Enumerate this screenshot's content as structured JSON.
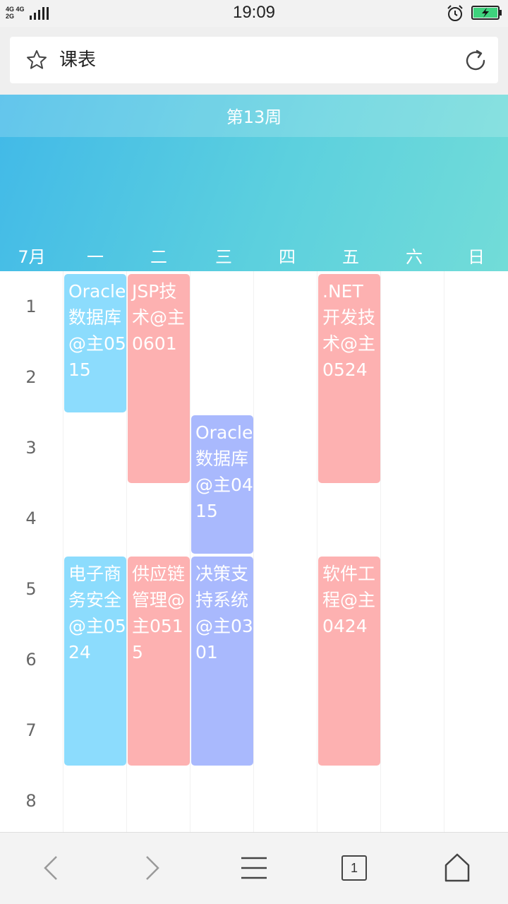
{
  "status": {
    "time": "19:09",
    "network_top": "4G 4G",
    "network_bottom": "2G"
  },
  "header": {
    "title": "课表"
  },
  "timetable": {
    "week_label": "第13周",
    "month_label": "7月",
    "days": [
      "一",
      "二",
      "三",
      "四",
      "五",
      "六",
      "日"
    ],
    "periods": [
      "1",
      "2",
      "3",
      "4",
      "5",
      "6",
      "7",
      "8"
    ],
    "courses": [
      {
        "name": "Oracle数据库@主0515",
        "day": "一",
        "start": 1,
        "end": 2,
        "color": "#8cdcfd"
      },
      {
        "name": "JSP技术@主0601",
        "day": "二",
        "start": 1,
        "end": 3,
        "color": "#fdb1b1"
      },
      {
        "name": ".NET开发技术@主0524",
        "day": "五",
        "start": 1,
        "end": 3,
        "color": "#fdb1b1"
      },
      {
        "name": "Oracle数据库@主0415",
        "day": "三",
        "start": 3,
        "end": 4,
        "color": "#a9b9fd"
      },
      {
        "name": "电子商务安全@主0524",
        "day": "一",
        "start": 5,
        "end": 7,
        "color": "#8cdcfd"
      },
      {
        "name": "供应链管理@主0515",
        "day": "二",
        "start": 5,
        "end": 7,
        "color": "#fdb1b1"
      },
      {
        "name": "决策支持系统@主0301",
        "day": "三",
        "start": 5,
        "end": 7,
        "color": "#a9b9fd"
      },
      {
        "name": "软件工程@主0424",
        "day": "五",
        "start": 5,
        "end": 7,
        "color": "#fdb1b1"
      }
    ]
  },
  "bottom_nav": {
    "tab_count": "1",
    "icons": [
      "back-icon",
      "forward-icon",
      "menu-icon",
      "tabs-icon",
      "home-icon"
    ]
  }
}
